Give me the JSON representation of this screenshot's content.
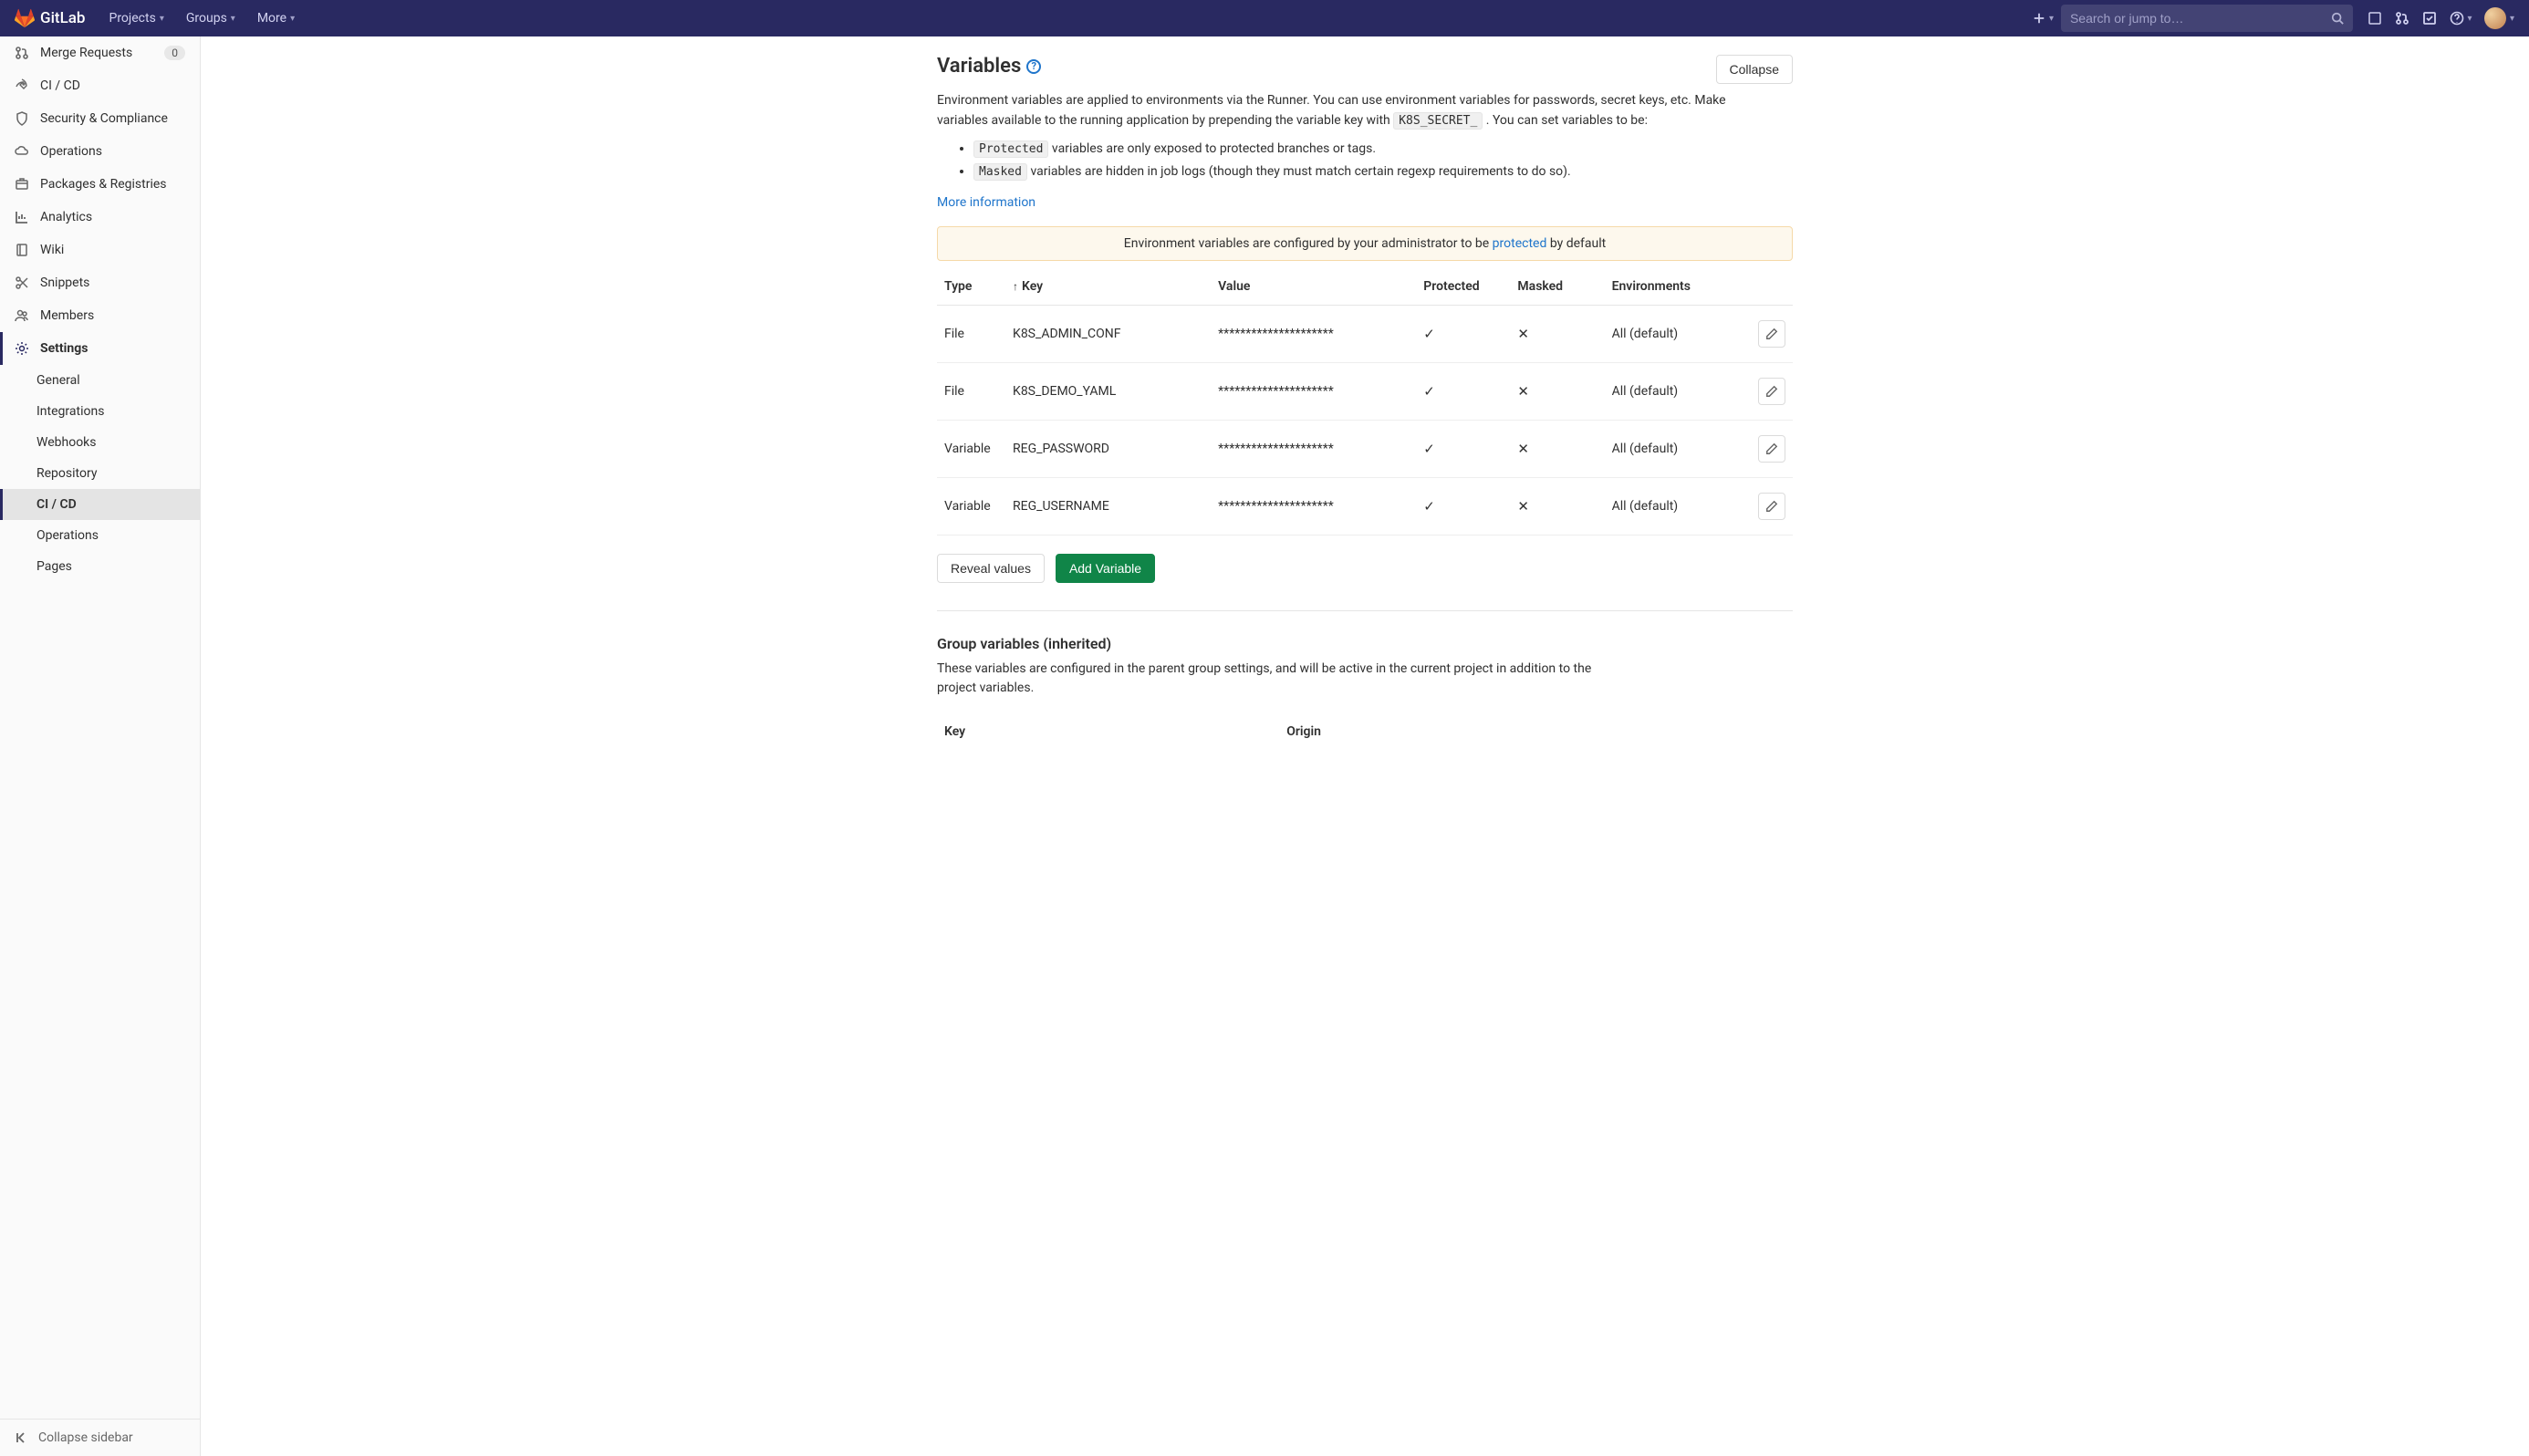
{
  "topbar": {
    "brand": "GitLab",
    "nav": {
      "projects": "Projects",
      "groups": "Groups",
      "more": "More"
    },
    "search_placeholder": "Search or jump to…"
  },
  "sidebar": {
    "items": [
      {
        "label": "Merge Requests",
        "badge": "0",
        "icon": "merge"
      },
      {
        "label": "CI / CD",
        "icon": "rocket"
      },
      {
        "label": "Security & Compliance",
        "icon": "shield"
      },
      {
        "label": "Operations",
        "icon": "cloud"
      },
      {
        "label": "Packages & Registries",
        "icon": "package"
      },
      {
        "label": "Analytics",
        "icon": "chart"
      },
      {
        "label": "Wiki",
        "icon": "book"
      },
      {
        "label": "Snippets",
        "icon": "scissors"
      },
      {
        "label": "Members",
        "icon": "users"
      },
      {
        "label": "Settings",
        "icon": "gear",
        "active_parent": true
      }
    ],
    "settings_sub": [
      {
        "label": "General"
      },
      {
        "label": "Integrations"
      },
      {
        "label": "Webhooks"
      },
      {
        "label": "Repository"
      },
      {
        "label": "CI / CD",
        "active": true
      },
      {
        "label": "Operations"
      },
      {
        "label": "Pages"
      }
    ],
    "collapse_label": "Collapse sidebar"
  },
  "variables": {
    "title": "Variables",
    "collapse_btn": "Collapse",
    "desc_1": "Environment variables are applied to environments via the Runner. You can use environment variables for passwords, secret keys, etc. Make variables available to the running application by prepending the variable key with ",
    "secret_code": "K8S_SECRET_",
    "desc_2": " . You can set variables to be:",
    "bullet1_code": "Protected",
    "bullet1_text": " variables are only exposed to protected branches or tags.",
    "bullet2_code": "Masked",
    "bullet2_text": " variables are hidden in job logs (though they must match certain regexp requirements to do so).",
    "more_info": "More information",
    "alert_pre": "Environment variables are configured by your administrator to be ",
    "alert_link": "protected",
    "alert_post": " by default",
    "th": {
      "type": "Type",
      "key": "Key",
      "value": "Value",
      "protected": "Protected",
      "masked": "Masked",
      "env": "Environments"
    },
    "rows": [
      {
        "type": "File",
        "key": "K8S_ADMIN_CONF",
        "value": "*********************",
        "protected": true,
        "masked": false,
        "env": "All (default)"
      },
      {
        "type": "File",
        "key": "K8S_DEMO_YAML",
        "value": "*********************",
        "protected": true,
        "masked": false,
        "env": "All (default)"
      },
      {
        "type": "Variable",
        "key": "REG_PASSWORD",
        "value": "*********************",
        "protected": true,
        "masked": false,
        "env": "All (default)"
      },
      {
        "type": "Variable",
        "key": "REG_USERNAME",
        "value": "*********************",
        "protected": true,
        "masked": false,
        "env": "All (default)"
      }
    ],
    "reveal_btn": "Reveal values",
    "add_btn": "Add Variable"
  },
  "group_vars": {
    "title": "Group variables (inherited)",
    "desc": "These variables are configured in the parent group settings, and will be active in the current project in addition to the project variables.",
    "th": {
      "key": "Key",
      "origin": "Origin"
    }
  }
}
